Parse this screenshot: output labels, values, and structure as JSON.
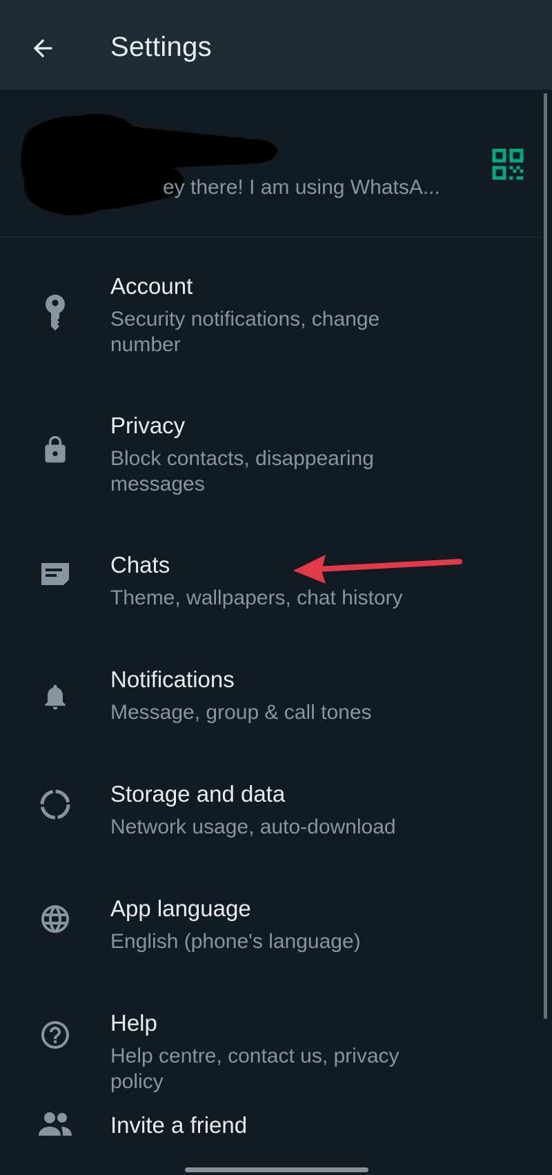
{
  "header": {
    "title": "Settings"
  },
  "profile": {
    "status": "ey there! I am using WhatsA..."
  },
  "menu": [
    {
      "label": "Account",
      "sub": "Security notifications, change number",
      "icon": "key-icon"
    },
    {
      "label": "Privacy",
      "sub": "Block contacts, disappearing messages",
      "icon": "lock-icon"
    },
    {
      "label": "Chats",
      "sub": "Theme, wallpapers, chat history",
      "icon": "chat-icon"
    },
    {
      "label": "Notifications",
      "sub": "Message, group & call tones",
      "icon": "bell-icon"
    },
    {
      "label": "Storage and data",
      "sub": "Network usage, auto-download",
      "icon": "storage-circle-icon"
    },
    {
      "label": "App language",
      "sub": "English (phone's language)",
      "icon": "globe-icon"
    },
    {
      "label": "Help",
      "sub": "Help centre, contact us, privacy policy",
      "icon": "help-icon"
    },
    {
      "label": "Invite a friend",
      "icon": "people-icon"
    }
  ],
  "colors": {
    "accent": "#00a884",
    "annotation_arrow": "#e33a4a",
    "background": "#111b21",
    "appbar": "#1f2c34"
  }
}
